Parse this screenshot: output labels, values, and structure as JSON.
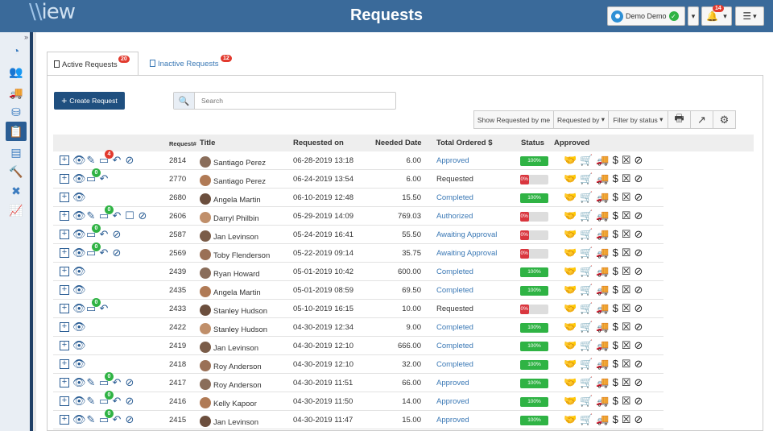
{
  "app": {
    "logo_text": "iew",
    "page_title": "Requests"
  },
  "user": {
    "name": "Demo Demo",
    "notifications": "14"
  },
  "tabs": [
    {
      "label": "Active Requests",
      "badge": "20"
    },
    {
      "label": "Inactive Requests",
      "badge": "12"
    }
  ],
  "toolbar": {
    "create_label": "Create Request",
    "search_placeholder": "Search",
    "filters": [
      "Show Requested by me",
      "Requested by",
      "Filter by status"
    ]
  },
  "table": {
    "headers": [
      "Request#",
      "Title",
      "Requested on",
      "Needed Date",
      "Total Ordered $",
      "Status",
      "Approved"
    ],
    "rows": [
      {
        "id": "2814",
        "title": "Santiago Perez",
        "requested": "06-28-2019 13:18",
        "needed": "6.00",
        "status": "Approved",
        "progress": "100%",
        "actions": [
          "expand",
          "view",
          "edit",
          "notes",
          "reply",
          "cancel"
        ],
        "note_badge": "4",
        "note_badge_color": "#e23a2e"
      },
      {
        "id": "2770",
        "title": "Santiago Perez",
        "requested": "06-24-2019 13:54",
        "needed": "6.00",
        "status": "Requested",
        "progress": "0%",
        "actions": [
          "expand",
          "view",
          "notes",
          "reply"
        ],
        "note_badge": "0",
        "note_badge_color": "#2fb344"
      },
      {
        "id": "2680",
        "title": "Angela Martin",
        "requested": "06-10-2019 12:48",
        "needed": "15.50",
        "status": "Completed",
        "progress": "100%",
        "actions": [
          "expand",
          "view"
        ],
        "note_badge": "",
        "note_badge_color": ""
      },
      {
        "id": "2606",
        "title": "Darryl Philbin",
        "requested": "05-29-2019 14:09",
        "needed": "769.03",
        "status": "Authorized",
        "progress": "0%",
        "actions": [
          "expand",
          "view",
          "edit",
          "notes",
          "reply",
          "square",
          "cancel"
        ],
        "note_badge": "0",
        "note_badge_color": "#2fb344"
      },
      {
        "id": "2587",
        "title": "Jan Levinson",
        "requested": "05-24-2019 16:41",
        "needed": "55.50",
        "status": "Awaiting Approval",
        "progress": "0%",
        "actions": [
          "expand",
          "view",
          "notes",
          "reply",
          "cancel"
        ],
        "note_badge": "0",
        "note_badge_color": "#2fb344"
      },
      {
        "id": "2569",
        "title": "Toby Flenderson",
        "requested": "05-22-2019 09:14",
        "needed": "35.75",
        "status": "Awaiting Approval",
        "progress": "0%",
        "actions": [
          "expand",
          "view",
          "notes",
          "reply",
          "cancel"
        ],
        "note_badge": "0",
        "note_badge_color": "#2fb344"
      },
      {
        "id": "2439",
        "title": "Ryan Howard",
        "requested": "05-01-2019 10:42",
        "needed": "600.00",
        "status": "Completed",
        "progress": "100%",
        "actions": [
          "expand",
          "view"
        ],
        "note_badge": "",
        "note_badge_color": ""
      },
      {
        "id": "2435",
        "title": "Angela Martin",
        "requested": "05-01-2019 08:59",
        "needed": "69.50",
        "status": "Completed",
        "progress": "100%",
        "actions": [
          "expand",
          "view"
        ],
        "note_badge": "",
        "note_badge_color": ""
      },
      {
        "id": "2433",
        "title": "Stanley Hudson",
        "requested": "05-10-2019 16:15",
        "needed": "10.00",
        "status": "Requested",
        "progress": "0%",
        "actions": [
          "expand",
          "view",
          "notes",
          "reply"
        ],
        "note_badge": "0",
        "note_badge_color": "#2fb344"
      },
      {
        "id": "2422",
        "title": "Stanley Hudson",
        "requested": "04-30-2019 12:34",
        "needed": "9.00",
        "status": "Completed",
        "progress": "100%",
        "actions": [
          "expand",
          "view"
        ],
        "note_badge": "",
        "note_badge_color": ""
      },
      {
        "id": "2419",
        "title": "Jan Levinson",
        "requested": "04-30-2019 12:10",
        "needed": "666.00",
        "status": "Completed",
        "progress": "100%",
        "actions": [
          "expand",
          "view"
        ],
        "note_badge": "",
        "note_badge_color": ""
      },
      {
        "id": "2418",
        "title": "Roy Anderson",
        "requested": "04-30-2019 12:10",
        "needed": "32.00",
        "status": "Completed",
        "progress": "100%",
        "actions": [
          "expand",
          "view"
        ],
        "note_badge": "",
        "note_badge_color": ""
      },
      {
        "id": "2417",
        "title": "Roy Anderson",
        "requested": "04-30-2019 11:51",
        "needed": "66.00",
        "status": "Approved",
        "progress": "100%",
        "actions": [
          "expand",
          "view",
          "edit",
          "notes",
          "reply",
          "cancel"
        ],
        "note_badge": "0",
        "note_badge_color": "#2fb344"
      },
      {
        "id": "2416",
        "title": "Kelly Kapoor",
        "requested": "04-30-2019 11:50",
        "needed": "14.00",
        "status": "Approved",
        "progress": "100%",
        "actions": [
          "expand",
          "view",
          "edit",
          "notes",
          "reply",
          "cancel"
        ],
        "note_badge": "0",
        "note_badge_color": "#2fb344"
      },
      {
        "id": "2415",
        "title": "Jan Levinson",
        "requested": "04-30-2019 11:47",
        "needed": "15.00",
        "status": "Approved",
        "progress": "100%",
        "actions": [
          "expand",
          "view",
          "edit",
          "notes",
          "reply",
          "cancel"
        ],
        "note_badge": "0",
        "note_badge_color": "#2fb344"
      }
    ]
  },
  "colors": {
    "link": "#3a78b5",
    "progress_full": "#2fb344",
    "progress_empty": "#d9363e",
    "approved_green": "#2fb344"
  }
}
